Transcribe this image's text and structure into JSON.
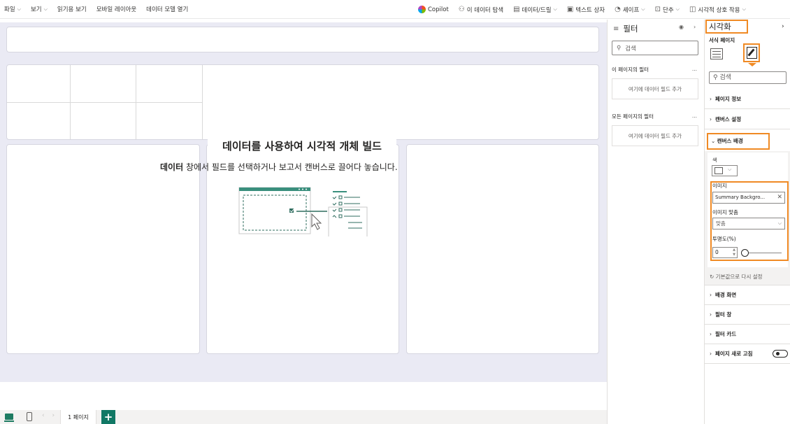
{
  "ribbon": {
    "left_items": [
      {
        "label": "파일",
        "has_caret": true
      },
      {
        "label": "보기",
        "has_caret": true
      },
      {
        "label": "읽기용 보기",
        "has_caret": false
      },
      {
        "label": "모바일 레이아웃",
        "has_caret": false
      },
      {
        "label": "데이터 모델 열기",
        "has_caret": false
      }
    ],
    "copilot": "Copilot",
    "explore": "이 데이터 탐색",
    "data_drill": "데이터/드릴",
    "textbox": "텍스트 상자",
    "shapes": "셰이프",
    "buttons": "단추",
    "visual_interactions": "시각적 상호 작용"
  },
  "canvas": {
    "build_title": "데이터를 사용하여 시각적 개체 빌드",
    "build_sub_bold": "데이터",
    "build_sub_rest": " 창에서 필드를 선택하거나 보고서 캔버스로 끌어다 놓습니다."
  },
  "pages": {
    "tab_label": "1 페이지",
    "add_label": "+"
  },
  "filters": {
    "title": "필터",
    "search_placeholder": "검색",
    "this_page_label": "이 페이지의 필터",
    "this_page_drop": "여기에 데이터 필드 추가",
    "all_pages_label": "모든 페이지의 필터",
    "all_pages_drop": "여기에 데이터 필드 추가",
    "more": "..."
  },
  "visualizations": {
    "title": "시각화",
    "format_page_label": "서식 페이지",
    "search_placeholder": "검색",
    "sections_top": [
      {
        "label": "페이지 정보"
      },
      {
        "label": "캔버스 설정"
      }
    ],
    "canvas_background": {
      "label": "캔버스 배경",
      "color_label": "색",
      "image_label": "이미지",
      "image_value": "Summary Backgro...",
      "image_fit_label": "이미지 맞춤",
      "image_fit_value": "맞춤",
      "transparency_label": "투명도(%)",
      "transparency_value": "0",
      "transparency_fraction": 0,
      "reset_label": "기본값으로 다시 설정"
    },
    "sections_bottom": [
      {
        "label": "배경 화면"
      },
      {
        "label": "필터 창"
      },
      {
        "label": "필터 카드"
      },
      {
        "label": "페이지 새로 고침"
      }
    ],
    "accent_color": "#f08a24"
  }
}
